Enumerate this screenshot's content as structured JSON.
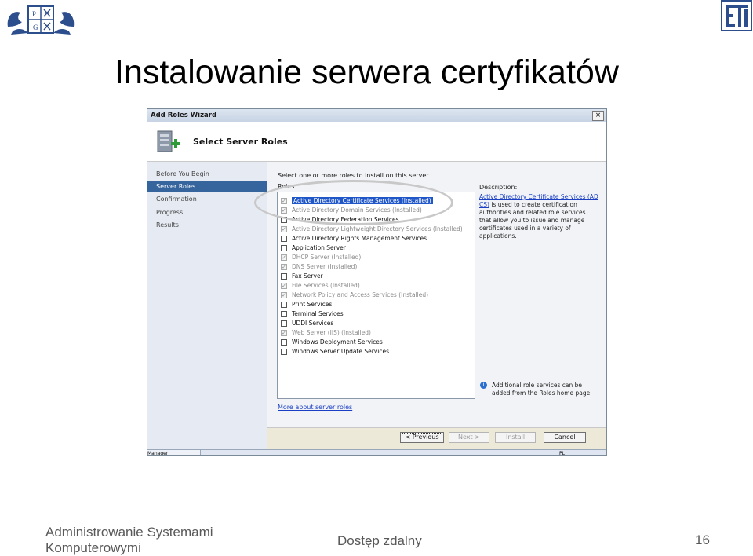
{
  "slide": {
    "title": "Instalowanie serwera certyfikatów",
    "footer_left_line1": "Administrowanie Systemami",
    "footer_left_line2": "Komputerowymi",
    "footer_center": "Dostęp zdalny",
    "page_number": "16",
    "logo_pg_letters": [
      "P",
      "G"
    ]
  },
  "window": {
    "title": "Add Roles Wizard",
    "close_glyph": "×",
    "header": "Select Server Roles",
    "nav": [
      "Before You Begin",
      "Server Roles",
      "Confirmation",
      "Progress",
      "Results"
    ],
    "nav_selected": "Server Roles",
    "instructions": "Select one or more roles to install on this server.",
    "roles_label": "Roles:",
    "roles": [
      {
        "label": "Active Directory Certificate Services  (Installed)",
        "checked": true,
        "disabled": true,
        "selected": true
      },
      {
        "label": "Active Directory Domain Services  (Installed)",
        "checked": true,
        "disabled": true
      },
      {
        "label": "Active Directory Federation Services",
        "checked": false,
        "disabled": false
      },
      {
        "label": "Active Directory Lightweight Directory Services  (Installed)",
        "checked": true,
        "disabled": true
      },
      {
        "label": "Active Directory Rights Management Services",
        "checked": false,
        "disabled": false
      },
      {
        "label": "Application Server",
        "checked": false,
        "disabled": false
      },
      {
        "label": "DHCP Server  (Installed)",
        "checked": true,
        "disabled": true
      },
      {
        "label": "DNS Server  (Installed)",
        "checked": true,
        "disabled": true
      },
      {
        "label": "Fax Server",
        "checked": false,
        "disabled": false
      },
      {
        "label": "File Services  (Installed)",
        "checked": true,
        "disabled": true
      },
      {
        "label": "Network Policy and Access Services  (Installed)",
        "checked": true,
        "disabled": true
      },
      {
        "label": "Print Services",
        "checked": false,
        "disabled": false
      },
      {
        "label": "Terminal Services",
        "checked": false,
        "disabled": false
      },
      {
        "label": "UDDI Services",
        "checked": false,
        "disabled": false
      },
      {
        "label": "Web Server (IIS)  (Installed)",
        "checked": true,
        "disabled": true
      },
      {
        "label": "Windows Deployment Services",
        "checked": false,
        "disabled": false
      },
      {
        "label": "Windows Server Update Services",
        "checked": false,
        "disabled": false
      }
    ],
    "description_label": "Description:",
    "description_link": "Active Directory Certificate Services (AD CS)",
    "description_text": " is used to create certification authorities and related role services that allow you to issue and manage certificates used in a variety of applications.",
    "info_text": "Additional role services can be added from the Roles home page.",
    "more_link": "More about server roles",
    "buttons": {
      "previous": "< Previous",
      "next": "Next >",
      "install": "Install",
      "cancel": "Cancel"
    },
    "taskbar_label": "Manager",
    "tray_text": "PL"
  },
  "colors": {
    "nav_selected": "#36659e",
    "link": "#1a3fc4",
    "selection": "#1f56c8"
  }
}
